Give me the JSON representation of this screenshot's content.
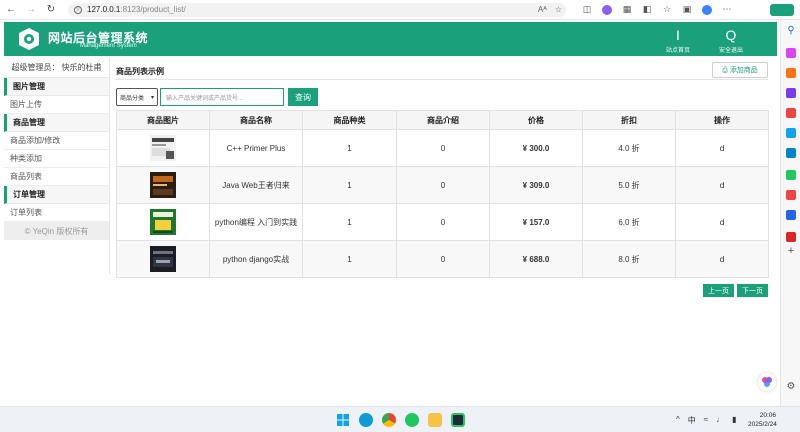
{
  "browser": {
    "url_host": "127.0.0.1",
    "url_path": ":8123/product_list/",
    "reader_icon": "Aᴬ"
  },
  "header": {
    "title": "网站后台管理系统",
    "subtitle": "Management System",
    "home_glyph": "I",
    "home_label": "站点首页",
    "logout_glyph": "Q",
    "logout_label": "安全退出",
    "color": "#1aa07a"
  },
  "sidebar": {
    "admin_label": "超级管理员：",
    "admin_name": "快乐的杜甫",
    "groups": [
      {
        "title": "图片管理",
        "items": [
          "图片上传"
        ]
      },
      {
        "title": "商品管理",
        "items": [
          "商品添加/修改",
          "种类添加",
          "商品列表"
        ]
      },
      {
        "title": "订单管理",
        "items": [
          "订单列表"
        ]
      }
    ],
    "copyright": "© YeQin 版权所有"
  },
  "main": {
    "title": "商品列表示例",
    "add_button": "⎙ 添加商品",
    "category_select": "商品分类",
    "search_placeholder": "输入产品关键词或产品货号...",
    "search_button": "查询",
    "columns": [
      "商品图片",
      "商品名称",
      "商品种类",
      "商品介绍",
      "价格",
      "折扣",
      "操作"
    ],
    "rows": [
      {
        "name": "C++ Primer Plus",
        "kind": "1",
        "intro": "0",
        "price": "¥ 300.0",
        "discount": "4.0 折",
        "op": "d"
      },
      {
        "name": "Java Web王者归来",
        "kind": "1",
        "intro": "0",
        "price": "¥ 309.0",
        "discount": "5.0 折",
        "op": "d"
      },
      {
        "name": "python编程 入门到实践",
        "kind": "1",
        "intro": "0",
        "price": "¥ 157.0",
        "discount": "6.0 折",
        "op": "d"
      },
      {
        "name": "python django实战",
        "kind": "1",
        "intro": "0",
        "price": "¥ 688.0",
        "discount": "8.0 折",
        "op": "d"
      }
    ],
    "prev_page": "上一页",
    "next_page": "下一页"
  },
  "taskbar": {
    "time": "20:06",
    "date": "2025/2/24",
    "chevron": "^",
    "lang": "中"
  }
}
